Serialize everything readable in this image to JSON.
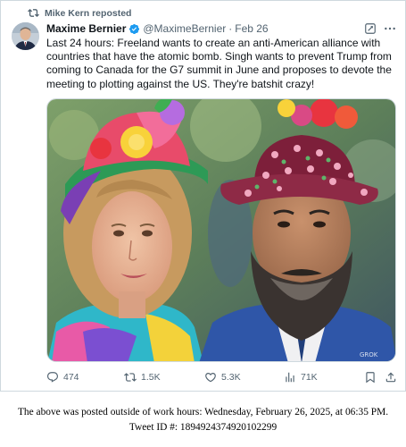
{
  "repost": {
    "text": "Mike Kern reposted",
    "icon": "repost-icon"
  },
  "author": {
    "name": "Maxime Bernier",
    "handle": "@MaximeBernier",
    "separator": "·",
    "date": "Feb 26",
    "verified": true
  },
  "tweet": {
    "text": "Last 24 hours: Freeland wants to create an anti-American alliance with countries that have the atomic bomb. Singh wants to prevent Trump from coming to Canada for the G7 summit in June and proposes to devote the meeting to plotting against the US. They're batshit crazy!"
  },
  "media": {
    "watermark": "GROK",
    "kind": "photo"
  },
  "actions": {
    "replies": "474",
    "reposts": "1.5K",
    "likes": "5.3K",
    "views": "71K"
  },
  "colors": {
    "text": "#0f1419",
    "muted": "#536471",
    "verified": "#1d9bf0",
    "border": "#cfd9de"
  },
  "footer": {
    "line1": "The above was posted outside of work hours: Wednesday, February 26, 2025, at 06:35 PM.",
    "line2": "Tweet ID #: 1894924374920102299"
  }
}
